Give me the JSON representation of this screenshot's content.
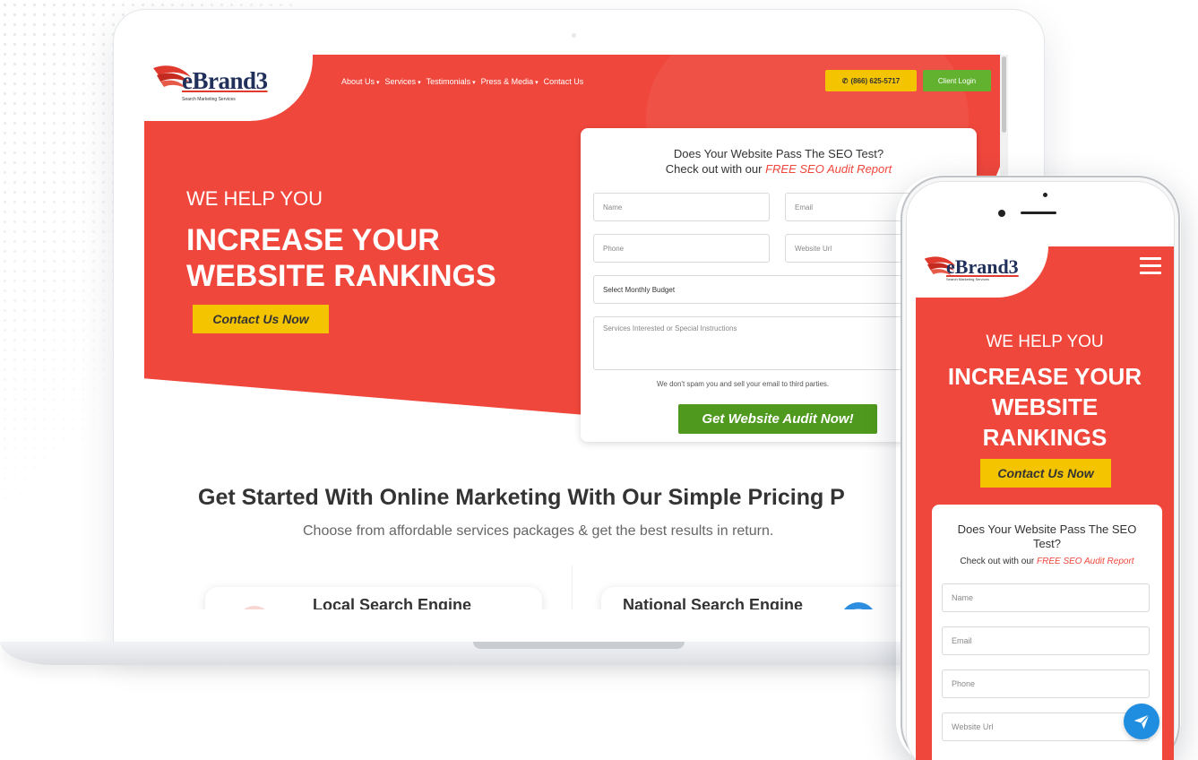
{
  "brand": {
    "logo_text": "eBrand3",
    "logo_tagline": "Search Marketing Services",
    "primary_color": "#f0473c",
    "yellow": "#f5c400",
    "green": "#4f9a1e"
  },
  "laptop": {
    "nav": {
      "items": [
        {
          "label": "About Us",
          "has_dropdown": true
        },
        {
          "label": "Services",
          "has_dropdown": true
        },
        {
          "label": "Testimonials",
          "has_dropdown": true
        },
        {
          "label": "Press & Media",
          "has_dropdown": true
        },
        {
          "label": "Contact Us",
          "has_dropdown": false
        }
      ],
      "phone_label": "(866) 625-5717",
      "login_label": "Client Login"
    },
    "hero": {
      "eyebrow": "WE HELP YOU",
      "headline_line1": "INCREASE YOUR",
      "headline_line2": "WEBSITE RANKINGS",
      "cta_label": "Contact Us Now"
    },
    "form": {
      "title_line1": "Does Your Website Pass The SEO Test?",
      "title_line2_prefix": "Check out with our",
      "title_line2_highlight": "FREE SEO Audit Report",
      "name_placeholder": "Name",
      "email_placeholder": "Email",
      "phone_placeholder": "Phone",
      "website_placeholder": "Website Url",
      "budget_select": "Select Monthly Budget",
      "message_placeholder": "Services Interested or Special Instructions",
      "note": "We don't spam you and sell your email to third parties.",
      "submit_label": "Get Website Audit Now!"
    },
    "pricing": {
      "title": "Get Started With Online Marketing With Our Simple Pricing P",
      "subtitle": "Choose from affordable services packages & get the best results in return.",
      "card1_label": "Local Search Engine",
      "card2_label": "National Search Engine"
    }
  },
  "mobile": {
    "hero": {
      "eyebrow": "WE HELP YOU",
      "headline_line1": "INCREASE YOUR",
      "headline_line2": "WEBSITE",
      "headline_line3": "RANKINGS",
      "cta_label": "Contact Us Now"
    },
    "form": {
      "title_line1": "Does Your Website Pass The SEO",
      "title_line2": "Test?",
      "sub_prefix": "Check out with our",
      "sub_highlight": "FREE SEO Audit Report",
      "name_placeholder": "Name",
      "email_placeholder": "Email",
      "phone_placeholder": "Phone",
      "website_placeholder": "Website Url"
    }
  }
}
